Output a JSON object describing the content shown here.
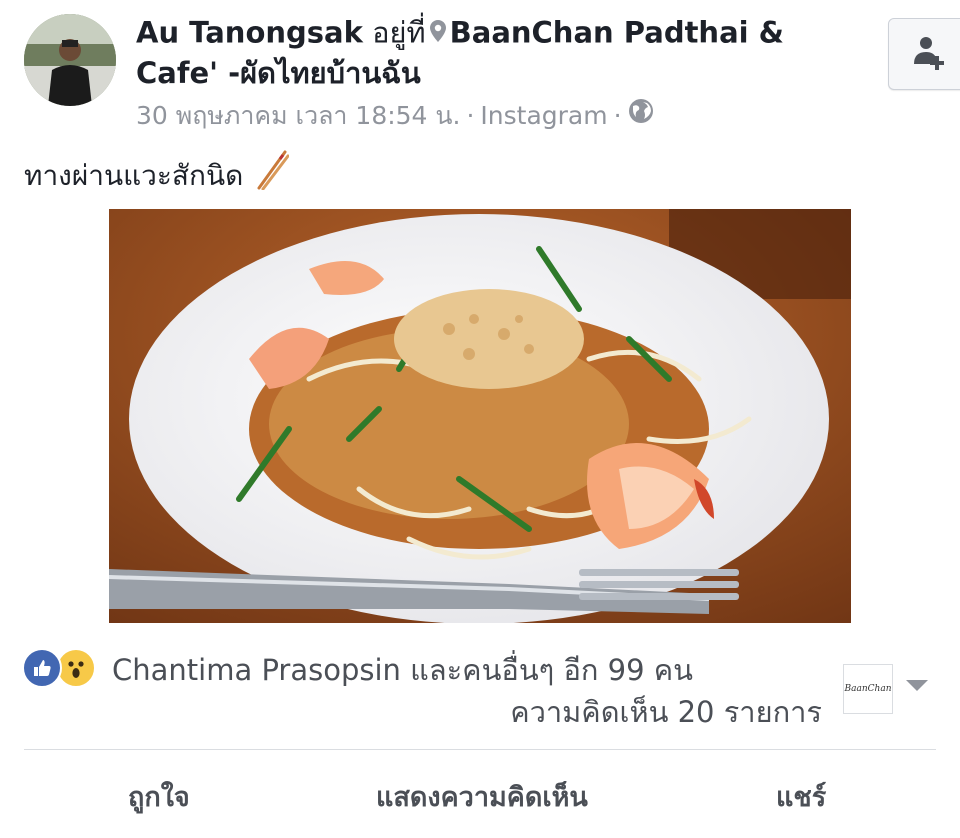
{
  "post": {
    "author": "Au Tanongsak",
    "at_text": "อยู่ที่",
    "place": "BaanChan Padthai & Cafe' -ผัดไทยบ้านฉัน",
    "date": "30 พฤษภาคม เวลา 18:54 น.",
    "separator": "·",
    "source": "Instagram",
    "caption": "ทางผ่านแวะสักนิด"
  },
  "reactions": {
    "summary": "Chantima Prasopsin และคนอื่นๆ อีก 99 คน",
    "comments": "ความคิดเห็น 20 รายการ",
    "icons": [
      "like-icon",
      "wow-icon"
    ]
  },
  "page_thumb": {
    "text": "BaanChan"
  },
  "actions": {
    "like": "ถูกใจ",
    "comment": "แสดงความคิดเห็น",
    "share": "แชร์"
  },
  "colors": {
    "like_blue": "#4267b2",
    "wow_yellow": "#f7c948",
    "meta_gray": "#90949c",
    "text_dark": "#1d2129"
  }
}
